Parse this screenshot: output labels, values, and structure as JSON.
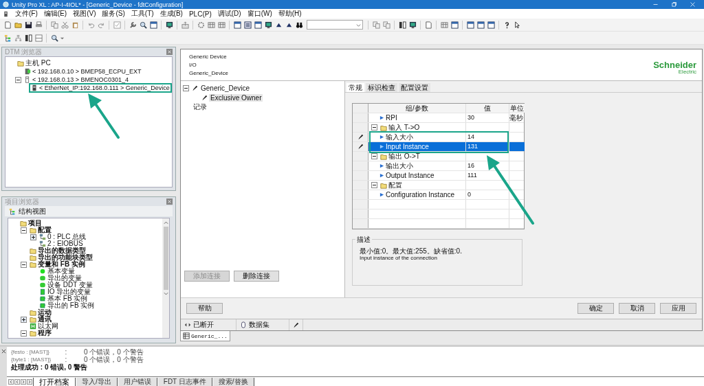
{
  "window": {
    "title": "Unity Pro XL : AP-I-4IOL* - [Generic_Device - fdtConfiguration]"
  },
  "menu": [
    "文件(F)",
    "编辑(E)",
    "视图(V)",
    "服务(S)",
    "工具(T)",
    "生成(B)",
    "PLC(P)",
    "调试(D)",
    "窗口(W)",
    "帮助(H)"
  ],
  "dtm_browser": {
    "title": "DTM 浏览器",
    "tree": [
      {
        "label": "主机 PC",
        "kind": "host",
        "children": [
          {
            "label": "< 192.168.0.10 > BMEP58_ECPU_EXT",
            "kind": "cpu"
          },
          {
            "label": "< 192.168.0.13 > BMENOC0301_4",
            "kind": "module",
            "expanded": true,
            "children": [
              {
                "label": "< EtherNet_IP:192.168.0.111 > Generic_Device",
                "kind": "device"
              }
            ]
          }
        ]
      }
    ]
  },
  "project_browser": {
    "title": "项目浏览器",
    "view": "结构视图",
    "tree": [
      {
        "label": "项目",
        "kind": "folder",
        "children": [
          {
            "label": "配置",
            "kind": "folder",
            "expanded": true,
            "children": [
              {
                "label": "0 : PLC 总线",
                "kind": "bus",
                "expanded": false
              },
              {
                "label": "2 : EIOBUS",
                "kind": "bus"
              }
            ]
          },
          {
            "label": "导出的数据类型",
            "kind": "folder"
          },
          {
            "label": "导出的功能块类型",
            "kind": "folder"
          },
          {
            "label": "变量和 FB 实例",
            "kind": "folder",
            "expanded": true,
            "children": [
              {
                "label": "基本变量",
                "kind": "variable"
              },
              {
                "label": "导出的变量",
                "kind": "shared_variable"
              },
              {
                "label": "设备 DDT 变量",
                "kind": "shared_variable"
              },
              {
                "label": "IO 导出的变量",
                "kind": "io_variable"
              },
              {
                "label": "基本 FB 实例",
                "kind": "fb"
              },
              {
                "label": "导出的 FB 实例",
                "kind": "fb"
              }
            ]
          },
          {
            "label": "运动",
            "kind": "folder"
          },
          {
            "label": "通讯",
            "kind": "folder",
            "expanded": false
          },
          {
            "label": "以太网",
            "kind": "ethernet"
          },
          {
            "label": "程序",
            "kind": "folder",
            "expanded": true
          }
        ]
      }
    ]
  },
  "editor": {
    "header": [
      "Generic Device",
      "I/O",
      "Generic_Device"
    ],
    "logo": {
      "name": "Schneider",
      "tagline": "Electric"
    },
    "tree": [
      {
        "label": "Generic_Device",
        "kind": "device",
        "selected": false,
        "expanded": true,
        "children": [
          {
            "label": "Exclusive Owner",
            "kind": "connection",
            "selected": true
          }
        ]
      },
      {
        "label": "记录",
        "kind": "log",
        "selected": false
      }
    ],
    "tabs": [
      {
        "label": "常规",
        "selected": true
      },
      {
        "label": "标识检查",
        "selected": false
      },
      {
        "label": "配置设置",
        "selected": false
      }
    ],
    "table": {
      "columns": [
        "组/参数",
        "值",
        "单位"
      ],
      "rows": [
        {
          "kind": "param",
          "name": "RPI",
          "value": "30",
          "unit": "毫秒",
          "edited": false,
          "selected": false
        },
        {
          "kind": "group",
          "name": "输入 T->O",
          "expanded": true,
          "selected": false,
          "children": [
            {
              "kind": "param",
              "name": "输入大小",
              "value": "14",
              "edited": true,
              "selected": false
            },
            {
              "kind": "param",
              "name": "Input Instance",
              "value": "131",
              "edited": true,
              "selected": true
            }
          ]
        },
        {
          "kind": "group",
          "name": "输出 O->T",
          "expanded": true,
          "selected": false,
          "children": [
            {
              "kind": "param",
              "name": "输出大小",
              "value": "16",
              "edited": false,
              "selected": false
            },
            {
              "kind": "param",
              "name": "Output Instance",
              "value": "111",
              "edited": false,
              "selected": false
            }
          ]
        },
        {
          "kind": "group",
          "name": "配置",
          "expanded": true,
          "selected": false,
          "children": [
            {
              "kind": "param",
              "name": "Configuration Instance",
              "value": "0",
              "edited": false,
              "selected": false
            }
          ]
        }
      ]
    },
    "description": {
      "title": "描述",
      "lines": [
        "最小值:0。最大值:255。缺省值:0.",
        "Input instance of the connection"
      ]
    },
    "connection_buttons": [
      {
        "label": "添加连接",
        "disabled": true
      },
      {
        "label": "删除连接",
        "disabled": false
      }
    ],
    "help_button": "帮助",
    "dialog_buttons": [
      "确定",
      "取消",
      "应用"
    ],
    "status": [
      {
        "kind": "connection",
        "label": "已断开"
      },
      {
        "kind": "dataset",
        "label": "数据集"
      },
      {
        "kind": "edit"
      }
    ]
  },
  "document_tabs": [
    {
      "label": "Generic_...",
      "selected": true
    }
  ],
  "output": {
    "lines": [
      {
        "kind": "result",
        "source": "{festo : [MAST]}",
        "separator": ":",
        "message": "0 个错误，0 个警告"
      },
      {
        "kind": "result",
        "source": "{byte1 : [MAST]}",
        "separator": ":",
        "message": "0 个错误，0 个警告"
      },
      {
        "kind": "summary",
        "message": "处理成功 : 0 错误, 0 警告"
      }
    ],
    "tabs": [
      {
        "label": "打开档案",
        "selected": true
      },
      {
        "label": "导入/导出",
        "selected": false
      },
      {
        "label": "用户错误",
        "selected": false
      },
      {
        "label": "FDT 日志事件",
        "selected": false
      },
      {
        "label": "搜索/替换",
        "selected": false
      }
    ]
  }
}
